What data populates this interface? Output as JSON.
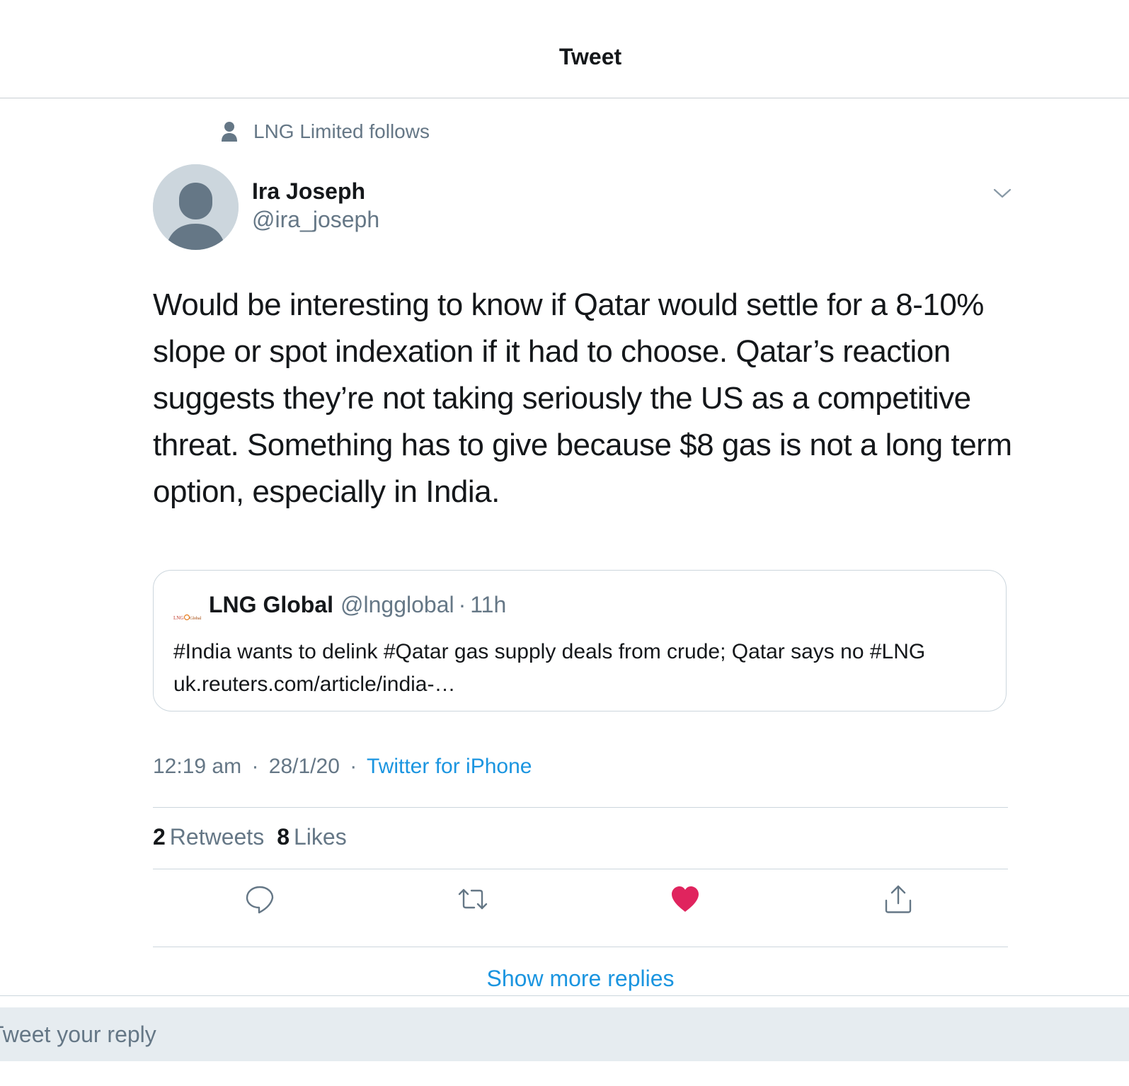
{
  "header": {
    "title": "Tweet"
  },
  "social_context": {
    "text": "LNG Limited follows",
    "icon": "person-icon"
  },
  "tweet": {
    "author_name": "Ira Joseph",
    "author_handle": "@ira_joseph",
    "text": "Would be interesting to know if Qatar would settle for a 8-10% slope or spot indexation if it had to choose. Qatar’s reaction suggests they’re not taking seriously the US as a competitive threat. Something has to give because $8 gas is not a long term option, especially in India.",
    "time": "12:19 am",
    "date": "28/1/20",
    "source": "Twitter for iPhone",
    "separator": "·"
  },
  "quoted_tweet": {
    "name": "LNG Global",
    "handle": "@lngglobal",
    "separator": "·",
    "age": "11h",
    "text": "#India wants to delink #Qatar gas supply deals from crude; Qatar says no #LNG uk.reuters.com/article/india-…",
    "logo": "LNG Global"
  },
  "stats": {
    "retweets_count": "2",
    "retweets_label": "Retweets",
    "likes_count": "8",
    "likes_label": "Likes"
  },
  "actions": {
    "reply": "reply-icon",
    "retweet": "retweet-icon",
    "like": "heart-icon",
    "share": "share-icon",
    "like_color": "#e0245e",
    "icon_color": "#657786"
  },
  "show_more": {
    "label": "Show more replies"
  },
  "reply": {
    "placeholder": "Tweet your reply"
  },
  "colors": {
    "link": "#1b95e0",
    "secondary_text": "#657786",
    "primary_text": "#14171a",
    "divider": "#ccd6dd",
    "reply_bar": "#e6ecf0"
  }
}
